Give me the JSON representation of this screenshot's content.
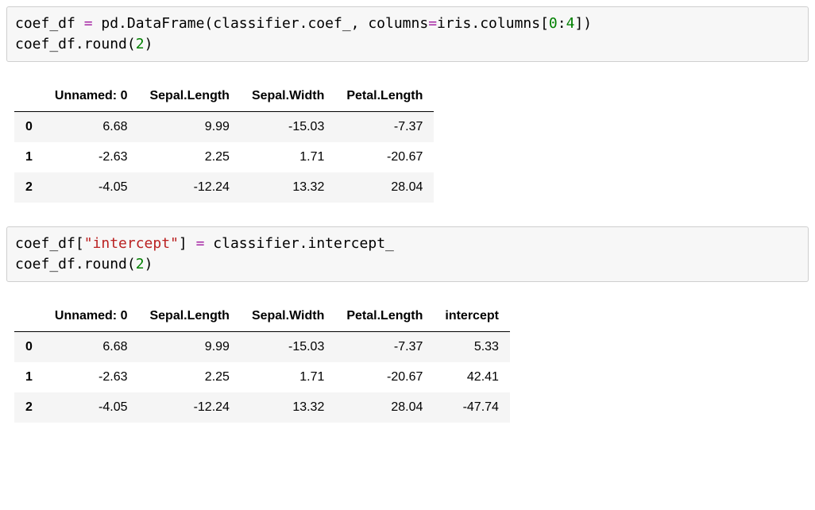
{
  "code1": {
    "part1": "coef_df ",
    "op1": "=",
    "part2": " pd.DataFrame(classifier.coef_, columns",
    "op2": "=",
    "part3": "iris.columns[",
    "num_a": "0",
    "colon": ":",
    "num_b": "4",
    "part4": "])\ncoef_df.round(",
    "num_c": "2",
    "part5": ")"
  },
  "table1": {
    "columns": [
      "Unnamed: 0",
      "Sepal.Length",
      "Sepal.Width",
      "Petal.Length"
    ],
    "index": [
      "0",
      "1",
      "2"
    ],
    "rows": [
      [
        "6.68",
        "9.99",
        "-15.03",
        "-7.37"
      ],
      [
        "-2.63",
        "2.25",
        "1.71",
        "-20.67"
      ],
      [
        "-4.05",
        "-12.24",
        "13.32",
        "28.04"
      ]
    ]
  },
  "code2": {
    "part1": "coef_df[",
    "str1": "\"intercept\"",
    "part2": "] ",
    "op1": "=",
    "part3": " classifier.intercept_\ncoef_df.round(",
    "num_a": "2",
    "part4": ")"
  },
  "table2": {
    "columns": [
      "Unnamed: 0",
      "Sepal.Length",
      "Sepal.Width",
      "Petal.Length",
      "intercept"
    ],
    "index": [
      "0",
      "1",
      "2"
    ],
    "rows": [
      [
        "6.68",
        "9.99",
        "-15.03",
        "-7.37",
        "5.33"
      ],
      [
        "-2.63",
        "2.25",
        "1.71",
        "-20.67",
        "42.41"
      ],
      [
        "-4.05",
        "-12.24",
        "13.32",
        "28.04",
        "-47.74"
      ]
    ]
  }
}
